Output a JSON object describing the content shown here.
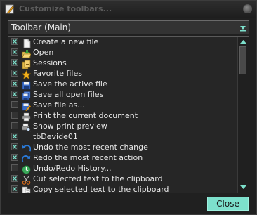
{
  "window": {
    "title": "Customize toolbars..."
  },
  "toolbar_select": {
    "value": "Toolbar (Main)"
  },
  "items": [
    {
      "label": "Create a new file",
      "checked": true,
      "icon": "new-file-icon"
    },
    {
      "label": "Open",
      "checked": true,
      "icon": "open-folder-icon"
    },
    {
      "label": "Sessions",
      "checked": true,
      "icon": "sessions-icon"
    },
    {
      "label": "Favorite files",
      "checked": true,
      "icon": "star-icon"
    },
    {
      "label": "Save the active file",
      "checked": true,
      "icon": "save-icon"
    },
    {
      "label": "Save all open files",
      "checked": true,
      "icon": "save-all-icon"
    },
    {
      "label": "Save file as...",
      "checked": false,
      "icon": "save-as-icon"
    },
    {
      "label": "Print the current document",
      "checked": false,
      "icon": "printer-icon"
    },
    {
      "label": "Show print preview",
      "checked": false,
      "icon": "print-preview-icon"
    },
    {
      "label": "tbDevide01",
      "checked": true,
      "icon": ""
    },
    {
      "label": "Undo the most recent change",
      "checked": true,
      "icon": "undo-icon"
    },
    {
      "label": "Redo the most recent action",
      "checked": true,
      "icon": "redo-icon"
    },
    {
      "label": "Undo/Redo History...",
      "checked": false,
      "icon": "history-icon"
    },
    {
      "label": "Cut selected text to the clipboard",
      "checked": true,
      "icon": "cut-icon"
    },
    {
      "label": "Copy selected text to the clipboard",
      "checked": true,
      "icon": "copy-icon"
    }
  ],
  "buttons": {
    "close": "Close"
  },
  "colors": {
    "accent": "#7de0cc",
    "background": "#202020"
  }
}
